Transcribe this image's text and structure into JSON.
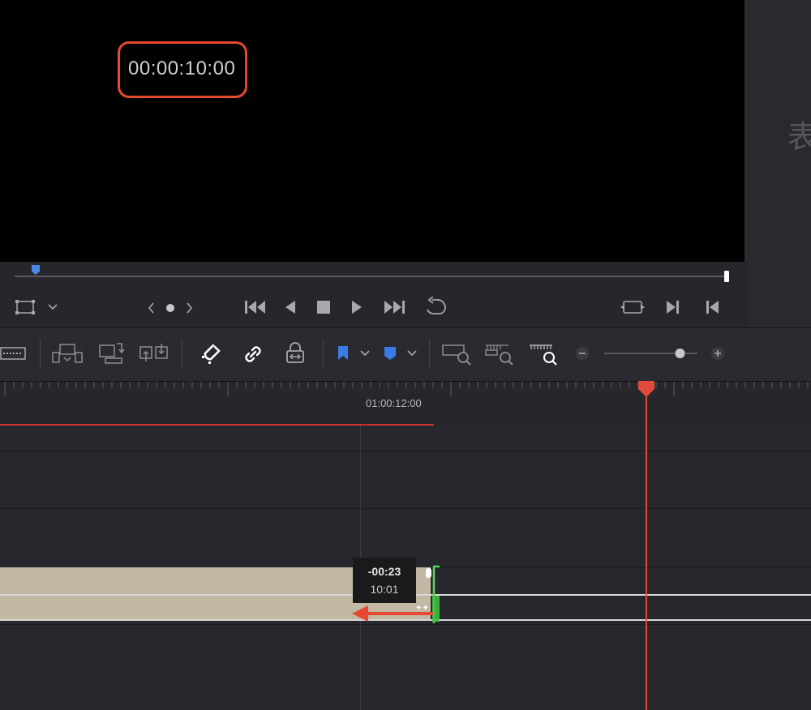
{
  "viewer": {
    "timecode": "00:00:10:00",
    "right_panel_char": "表"
  },
  "transport": {
    "clip_nav_label": "< ● >"
  },
  "toolbar": {
    "zoom_level": 0.85
  },
  "ruler": {
    "timecode_label": "01:00:12:00"
  },
  "tooltip": {
    "delta": "-00:23",
    "timecode": "10:01"
  },
  "colors": {
    "accent": "#e6492f",
    "playhead": "#e04a3a",
    "trim_handle": "#3fc43f",
    "clip": "#c2b8a3",
    "flag": "#3b7be8"
  }
}
